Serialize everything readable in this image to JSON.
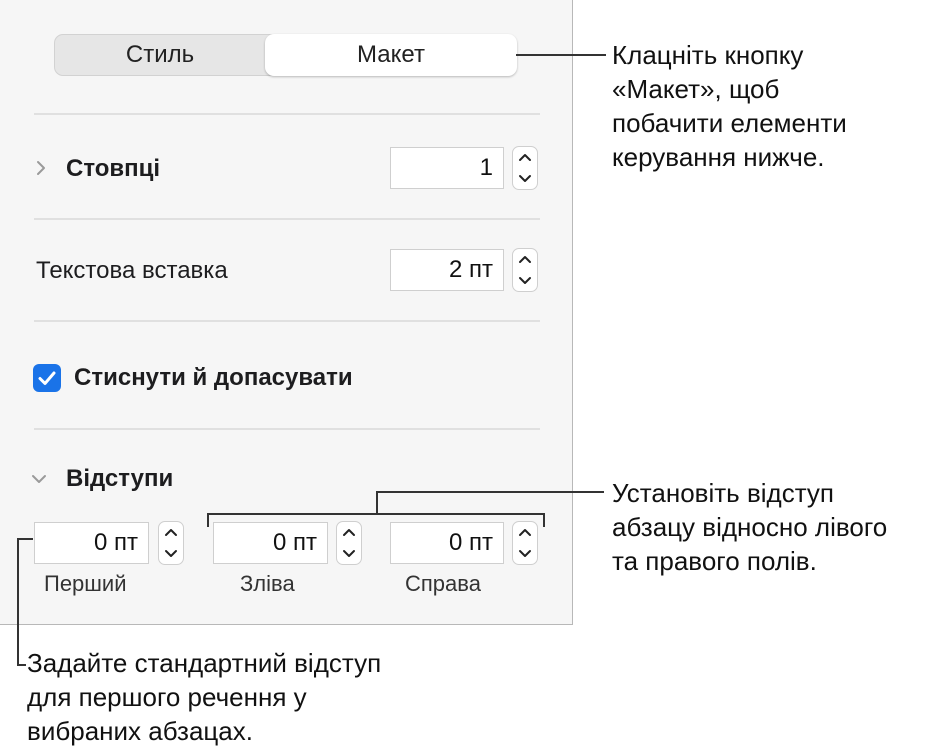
{
  "tabs": {
    "style_label": "Стиль",
    "layout_label": "Макет"
  },
  "columns": {
    "label": "Стовпці",
    "value": "1"
  },
  "text_inset": {
    "label": "Текстова вставка",
    "value": "2 пт"
  },
  "shrink": {
    "label": "Стиснути й допасувати",
    "checked": true
  },
  "indents": {
    "label": "Відступи",
    "first": {
      "value": "0 пт",
      "label": "Перший"
    },
    "left": {
      "value": "0 пт",
      "label": "Зліва"
    },
    "right": {
      "value": "0 пт",
      "label": "Справа"
    }
  },
  "callouts": {
    "layout_lines": [
      "Клацніть кнопку",
      "«Макет», щоб",
      "побачити елементи",
      "керування нижче."
    ],
    "margins_lines": [
      "Установіть відступ",
      "абзацу відносно лівого",
      "та правого полів."
    ],
    "first_line_lines": [
      "Задайте стандартний відступ",
      "для першого речення у",
      "вибраних абзацах."
    ]
  },
  "colors": {
    "accent": "#1a73e8",
    "panel_bg": "#f6f6f6"
  }
}
